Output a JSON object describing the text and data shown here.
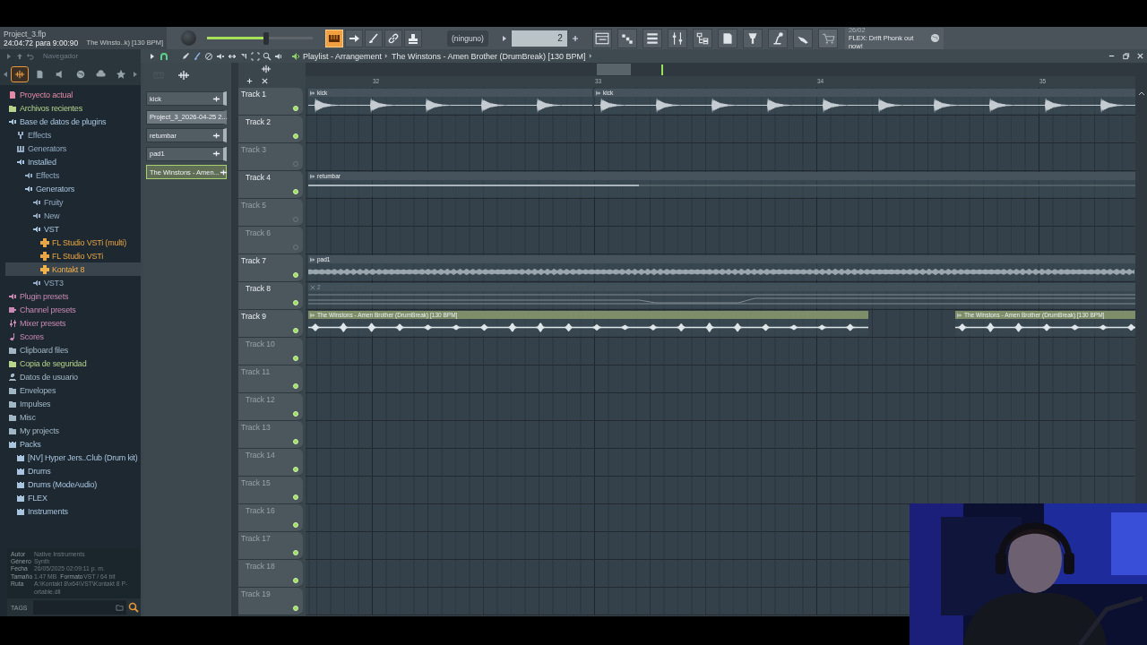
{
  "title_panel": {
    "project": "Project_3.flp",
    "time": "24:04:72 para 9:00:90",
    "hint": "The Winsto..k) [130 BPM]"
  },
  "toolbar": {
    "master_volume": {
      "level": 0.56
    },
    "buttons": [
      {
        "kind": "keyboard",
        "on": true
      },
      {
        "kind": "arrow",
        "on": false
      },
      {
        "kind": "brush",
        "on": false
      },
      {
        "kind": "link",
        "on": false
      },
      {
        "kind": "stamp",
        "on": false
      }
    ],
    "pattern_selector": "(ninguno)",
    "pattern_number": "2",
    "news": {
      "date": "26/02",
      "text": "FLEX: Drift Phonk out now!"
    }
  },
  "browser": {
    "title": "Navegador",
    "tabs": [
      {
        "kind": "wave",
        "selected": true
      },
      {
        "kind": "file",
        "selected": false
      },
      {
        "kind": "speaker",
        "selected": false
      },
      {
        "kind": "globe",
        "selected": false
      },
      {
        "kind": "cloud",
        "selected": false
      },
      {
        "kind": "star",
        "selected": false
      }
    ],
    "items": [
      {
        "label": "Proyecto actual",
        "kind": "file",
        "color": "#e58aa6",
        "selected": false
      },
      {
        "label": "Archivos recientes",
        "kind": "folder",
        "color": "#b7d38c",
        "selected": false
      },
      {
        "label": "Base de datos de plugins",
        "kind": "plugin",
        "color": "#a9c4de",
        "selected": false,
        "children": [
          {
            "label": "Effects",
            "kind": "fork",
            "color": "#94aac2",
            "selected": false
          },
          {
            "label": "Generators",
            "kind": "keys",
            "color": "#94aac2",
            "selected": false
          },
          {
            "label": "Installed",
            "kind": "plugin",
            "color": "#a9c4de",
            "selected": false,
            "children": [
              {
                "label": "Effects",
                "kind": "plugin",
                "color": "#94aac2",
                "selected": false
              },
              {
                "label": "Generators",
                "kind": "plugin",
                "color": "#a9c4de",
                "selected": false,
                "children": [
                  {
                    "label": "Fruity",
                    "kind": "plugin",
                    "color": "#94aac2",
                    "selected": false
                  },
                  {
                    "label": "New",
                    "kind": "plugin",
                    "color": "#94aac2",
                    "selected": false
                  },
                  {
                    "label": "VST",
                    "kind": "plugin",
                    "color": "#a9c4de",
                    "selected": false,
                    "children": [
                      {
                        "label": "FL Studio VSTi (multi)",
                        "kind": "vst",
                        "color": "#e8a543",
                        "selected": false
                      },
                      {
                        "label": "FL Studio VSTi",
                        "kind": "vst",
                        "color": "#e8a543",
                        "selected": false
                      },
                      {
                        "label": "Kontakt 8",
                        "kind": "vst",
                        "color": "#f0b04a",
                        "selected": true
                      }
                    ]
                  },
                  {
                    "label": "VST3",
                    "kind": "plugin",
                    "color": "#94aac2",
                    "selected": false
                  }
                ]
              }
            ]
          }
        ]
      },
      {
        "label": "Plugin presets",
        "kind": "plugin",
        "color": "#c889b4",
        "selected": false
      },
      {
        "label": "Channel presets",
        "kind": "channel",
        "color": "#c889b4",
        "selected": false
      },
      {
        "label": "Mixer presets",
        "kind": "sliders",
        "color": "#c889b4",
        "selected": false
      },
      {
        "label": "Scores",
        "kind": "note",
        "color": "#c889b4",
        "selected": false
      },
      {
        "label": "Clipboard files",
        "kind": "folder",
        "color": "#a2b7c6",
        "selected": false
      },
      {
        "label": "Copia de seguridad",
        "kind": "folder",
        "color": "#b7d38c",
        "selected": false
      },
      {
        "label": "Datos de usuario",
        "kind": "user",
        "color": "#a2b7c6",
        "selected": false
      },
      {
        "label": "Envelopes",
        "kind": "folder",
        "color": "#a2b7c6",
        "selected": false
      },
      {
        "label": "Impulses",
        "kind": "folder",
        "color": "#a2b7c6",
        "selected": false
      },
      {
        "label": "Misc",
        "kind": "folder",
        "color": "#a2b7c6",
        "selected": false
      },
      {
        "label": "My projects",
        "kind": "folder",
        "color": "#a2b7c6",
        "selected": false
      },
      {
        "label": "Packs",
        "kind": "pack",
        "color": "#a9c4de",
        "selected": false,
        "children": [
          {
            "label": "[NV] Hyper Jers..Club (Drum kit)",
            "kind": "pack",
            "color": "#a9c4de",
            "selected": false
          },
          {
            "label": "Drums",
            "kind": "pack",
            "color": "#a9c4de",
            "selected": false
          },
          {
            "label": "Drums (ModeAudio)",
            "kind": "pack",
            "color": "#a9c4de",
            "selected": false
          },
          {
            "label": "FLEX",
            "kind": "pack",
            "color": "#a9c4de",
            "selected": false
          },
          {
            "label": "Instruments",
            "kind": "pack",
            "color": "#a9c4de",
            "selected": false
          }
        ]
      }
    ],
    "info": [
      {
        "fields": [
          {
            "label": "Autor",
            "value": "Native Instruments"
          }
        ]
      },
      {
        "fields": [
          {
            "label": "Género",
            "value": "Synth"
          }
        ]
      },
      {
        "fields": [
          {
            "label": "Fecha",
            "value": "26/05/2025 02:09:11 p. m."
          }
        ]
      },
      {
        "fields": [
          {
            "label": "Tamaño",
            "value": "1.47 MB"
          },
          {
            "label": "Formato",
            "value": "VST / 64 bit"
          }
        ]
      },
      {
        "fields": [
          {
            "label": "Ruta",
            "value": "A:\\Kontakt 8\\x64\\VST\\Kontakt 8 P-ortable.dll"
          }
        ]
      }
    ],
    "tags_label": "TAGS"
  },
  "playlist": {
    "title": "Playlist - Arrangement",
    "pattern": "The Winstons - Amen Brother (DrumBreak) [130 BPM]",
    "bars": [
      "32",
      "33",
      "34",
      "35"
    ]
  },
  "channels": [
    {
      "name": "kick",
      "kind": "sample",
      "selected": false
    },
    {
      "name": "Project_3_2026-04-25 2...",
      "kind": "recording",
      "selected": false
    },
    {
      "name": "retumbar",
      "kind": "sample",
      "selected": false
    },
    {
      "name": "pad1",
      "kind": "sample",
      "selected": false
    },
    {
      "name": "The Winstons - Amen...",
      "kind": "sample",
      "selected": true
    }
  ],
  "tracks": [
    {
      "name": "Track 1",
      "dimmed": false,
      "led_on": true,
      "clips": [
        {
          "label": "kick",
          "kind": "kick",
          "color": "#46535d"
        },
        {
          "label": "kick",
          "kind": "kick",
          "color": "#46535d"
        }
      ]
    },
    {
      "name": "Track 2",
      "dimmed": false,
      "led_on": true
    },
    {
      "name": "Track 3",
      "dimmed": true,
      "led_on": false
    },
    {
      "name": "Track 4",
      "dimmed": false,
      "led_on": true,
      "clips": [
        {
          "label": "retumbar",
          "kind": "line",
          "color": "#46535d"
        }
      ]
    },
    {
      "name": "Track 5",
      "dimmed": true,
      "led_on": false
    },
    {
      "name": "Track 6",
      "dimmed": true,
      "led_on": false
    },
    {
      "name": "Track 7",
      "dimmed": false,
      "led_on": true,
      "clips": [
        {
          "label": "pad1",
          "kind": "pad",
          "color": "#46535d"
        }
      ]
    },
    {
      "name": "Track 8",
      "dimmed": false,
      "led_on": true,
      "clips": [
        {
          "label": "2",
          "kind": "automation",
          "color": "#42505a"
        }
      ]
    },
    {
      "name": "Track 9",
      "dimmed": false,
      "led_on": true,
      "clips": [
        {
          "label": "The Winstons - Amen Brother (DrumBreak) [130 BPM]",
          "kind": "break",
          "color": "#7d8e69"
        },
        {
          "label": "The Winstons - Amen Brother (DrumBreak) [130 BPM]",
          "kind": "break",
          "color": "#7d8e69"
        }
      ]
    },
    {
      "name": "Track 10",
      "dimmed": true,
      "led_on": true
    },
    {
      "name": "Track 11",
      "dimmed": true,
      "led_on": true
    },
    {
      "name": "Track 12",
      "dimmed": true,
      "led_on": true
    },
    {
      "name": "Track 13",
      "dimmed": true,
      "led_on": true
    },
    {
      "name": "Track 14",
      "dimmed": true,
      "led_on": true
    },
    {
      "name": "Track 15",
      "dimmed": true,
      "led_on": true
    },
    {
      "name": "Track 16",
      "dimmed": true,
      "led_on": true
    },
    {
      "name": "Track 17",
      "dimmed": true,
      "led_on": true
    },
    {
      "name": "Track 18",
      "dimmed": true,
      "led_on": true
    },
    {
      "name": "Track 19",
      "dimmed": true,
      "led_on": true
    }
  ]
}
